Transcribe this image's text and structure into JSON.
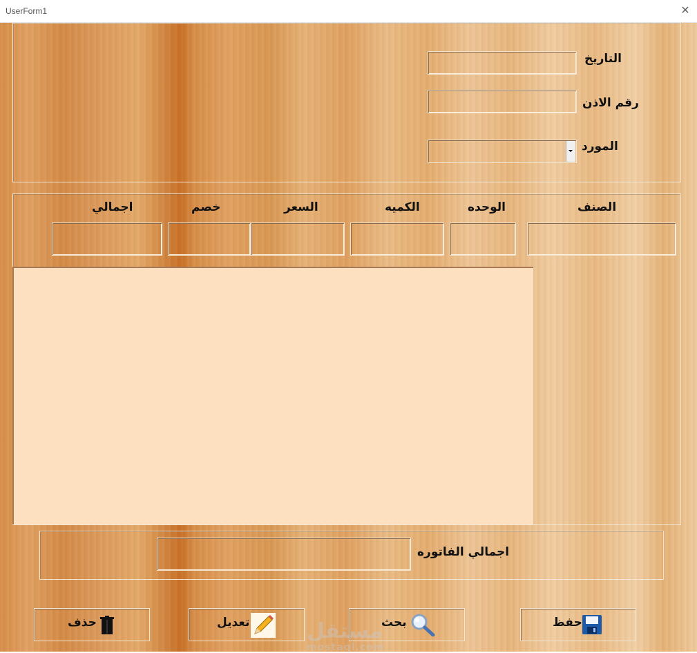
{
  "window": {
    "title": "UserForm1",
    "close_glyph": "✕"
  },
  "header": {
    "date_label": "التاريخ",
    "permit_number_label": "رقم الاذن",
    "supplier_label": "المورد",
    "date_value": "",
    "permit_number_value": "",
    "supplier_value": ""
  },
  "items": {
    "columns": [
      "الصنف",
      "الوحده",
      "الكميه",
      "السعر",
      "خصم",
      "اجمالي"
    ],
    "values": [
      "",
      "",
      "",
      "",
      "",
      ""
    ],
    "list_rows": []
  },
  "invoice_total": {
    "label": "اجمالي الفاتوره",
    "value": ""
  },
  "buttons": {
    "save": {
      "label": "حفظ",
      "icon": "floppy-disk-icon"
    },
    "search": {
      "label": "بحث",
      "icon": "magnifier-icon"
    },
    "edit": {
      "label": "تعديل",
      "icon": "pencil-icon"
    },
    "delete": {
      "label": "حذف",
      "icon": "trash-icon"
    }
  },
  "watermark": {
    "line1": "مستقل",
    "line2": "mostaql.com"
  },
  "colors": {
    "list_background": "#fde0c0",
    "wood_dark": "#c86f26",
    "wood_light": "#f0cda1"
  }
}
